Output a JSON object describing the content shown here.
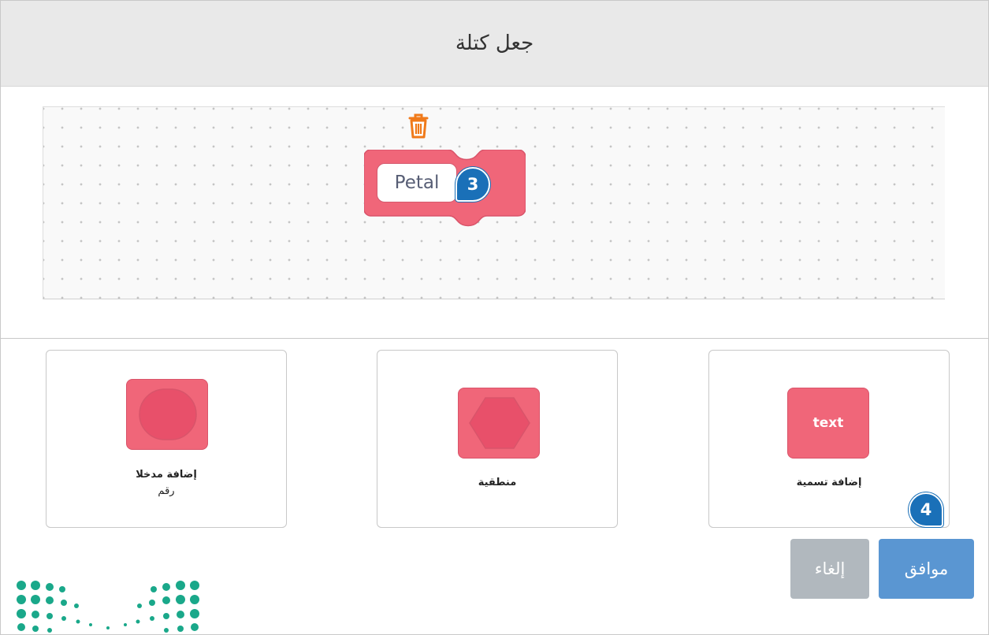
{
  "dialog": {
    "title": "جعل كتلة"
  },
  "workspace": {
    "block_name": "Petal",
    "trash_icon": "trash-icon"
  },
  "callouts": {
    "step3": "3",
    "step4": "4"
  },
  "options": {
    "number_input": {
      "caption_line1": "إضافة مدخلا",
      "caption_line2": "رقم"
    },
    "boolean_input": {
      "caption": "منطقية"
    },
    "label": {
      "chip_text": "text",
      "caption": "إضافة تسمية"
    }
  },
  "buttons": {
    "ok_label": "موافق",
    "cancel_label": "إلغاء"
  },
  "colors": {
    "block_pink": "#f06679",
    "callout_blue": "#1a70b8",
    "ok_blue": "#5a96d2",
    "cancel_gray": "#b1b8be",
    "logo_teal": "#1aa88a"
  }
}
